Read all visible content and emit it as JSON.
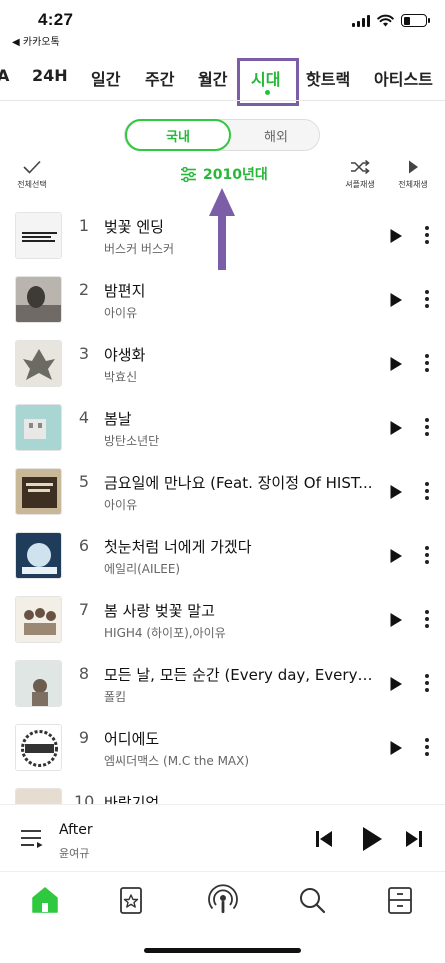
{
  "status": {
    "time": "4:27",
    "back_label": "◀ 카카오톡"
  },
  "tabs": [
    "A",
    "24H",
    "일간",
    "주간",
    "월간",
    "시대",
    "핫트랙",
    "아티스트"
  ],
  "active_tab": "시대",
  "toggle": {
    "selected": "국내",
    "other": "해외"
  },
  "controls": {
    "select_all": "전체선택",
    "shuffle": "셔플재생",
    "play_all": "전체재생"
  },
  "filter_label": "2010년대",
  "songs": [
    {
      "rank": "1",
      "title": "벚꽃 엔딩",
      "artist": "버스커 버스커"
    },
    {
      "rank": "2",
      "title": "밤편지",
      "artist": "아이유"
    },
    {
      "rank": "3",
      "title": "야생화",
      "artist": "박효신"
    },
    {
      "rank": "4",
      "title": "봄날",
      "artist": "방탄소년단"
    },
    {
      "rank": "5",
      "title": "금요일에 만나요 (Feat. 장이정 Of HIST...",
      "artist": "아이유"
    },
    {
      "rank": "6",
      "title": "첫눈처럼 너에게 가겠다",
      "artist": "에일리(AILEE)"
    },
    {
      "rank": "7",
      "title": "봄 사랑 벚꽃 말고",
      "artist": "HIGH4 (하이포),아이유"
    },
    {
      "rank": "8",
      "title": "모든 날, 모든 순간 (Every day, Every M...",
      "artist": "폴킴"
    },
    {
      "rank": "9",
      "title": "어디에도",
      "artist": "엠씨더맥스 (M.C the MAX)"
    },
    {
      "rank": "10",
      "title": "바람기억",
      "artist": ""
    }
  ],
  "now_playing": {
    "title": "After",
    "artist": "윤여규"
  },
  "accent_color": "#27b83a",
  "annotation_color": "#7b5ea7",
  "nav_icons": [
    "home-icon",
    "music-card-icon",
    "podcast-icon",
    "search-icon",
    "storage-box-icon"
  ]
}
